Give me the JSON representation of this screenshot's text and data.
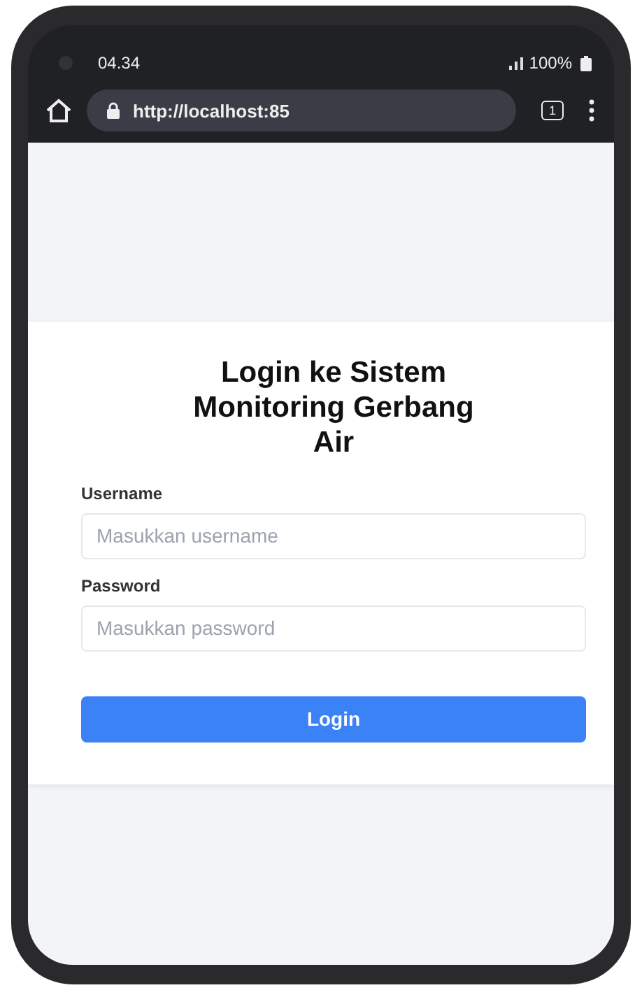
{
  "status_bar": {
    "time": "04.34",
    "battery": "100%"
  },
  "browser": {
    "url": "http://localhost:85",
    "tab_count": "1"
  },
  "login": {
    "title": "Login ke Sistem Monitoring Gerbang Air",
    "fields": [
      {
        "label": "Username",
        "placeholder": "Masukkan username"
      },
      {
        "label": "Password",
        "placeholder": "Masukkan password"
      }
    ],
    "button": "Login"
  }
}
